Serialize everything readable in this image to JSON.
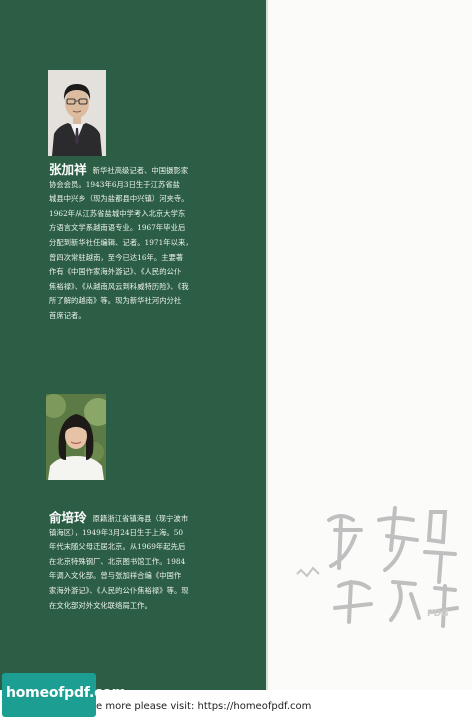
{
  "author1": {
    "name": "张加祥",
    "lead": "新华社高级记者、中国摄影家",
    "lines": [
      "协会会员。1943年6月3日生于江苏省盐",
      "城县中兴乡（现为盐都县中兴镇）河夹寺。",
      "1962年从江苏省盐城中学考入北京大学东",
      "方语言文学系越南语专业。1967年毕业后",
      "分配到新华社任编辑、记者。1971年以来，",
      "曾四次常驻越南，至今已达16年。主要著",
      "作有《中国作家海外游记》、《人民的公仆",
      "焦裕禄》、《从越南风云到科威特历险》、《我",
      "所了解的越南》等。现为新华社河内分社",
      "首席记者。"
    ]
  },
  "author2": {
    "name": "俞培玲",
    "lead": "原籍浙江省镇海县（现宁波市",
    "lines": [
      "镇海区），1949年3月24日生于上海。50",
      "年代末随父母迁居北京。从1969年起先后",
      "在北京特殊钢厂、北京图书馆工作。1984",
      "年调入文化部。曾与张加祥合编《中国作",
      "家海外游记》、《人民的公仆焦裕禄》等。现",
      "在文化部对外文化联络局工作。"
    ]
  },
  "watermark": {
    "stamp_text": "PDG"
  },
  "footer": {
    "logo": "homeofpdf.com",
    "text": "e more please visit: https://homeofpdf.com"
  },
  "colors": {
    "flap_green": "#2c5e46",
    "logo_teal": "#1c9f92"
  }
}
